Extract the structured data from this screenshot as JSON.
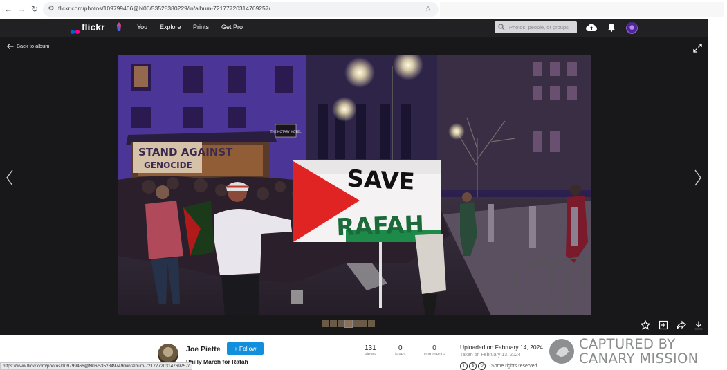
{
  "browser": {
    "url": "flickr.com/photos/109799466@N06/53528380229/in/album-72177720314769257/"
  },
  "header": {
    "logo": "flickr",
    "nav": [
      "You",
      "Explore",
      "Prints",
      "Get Pro"
    ],
    "search_placeholder": "Photos, people, or groups",
    "icons": [
      "upload-cloud-icon",
      "notification-bell-icon"
    ],
    "logo_colors": [
      "#0063dc",
      "#ff0084"
    ]
  },
  "viewer": {
    "back_label": "Back to album",
    "photo_signs": {
      "banner_top": "SAVE",
      "banner_bottom": "RAFAH",
      "sign_left": "STAND AGAINST GENOCIDE",
      "hotel_sign": "THE NOTARY HOTEL"
    },
    "filmstrip_count": 7,
    "actions": [
      "fave-star-icon",
      "add-to-album-icon",
      "share-icon",
      "download-icon"
    ]
  },
  "info": {
    "owner": "Joe Piette",
    "follow_label": "Follow",
    "title": "Philly March for Rafah",
    "stats": [
      {
        "value": "131",
        "label": "views"
      },
      {
        "value": "0",
        "label": "faves"
      },
      {
        "value": "0",
        "label": "comments"
      }
    ],
    "uploaded": "Uploaded on February 14, 2024",
    "taken": "Taken on February 13, 2024",
    "rights": "Some rights reserved",
    "follow_color": "#128fdc"
  },
  "status_url": "https://www.flickr.com/photos/109799466@N06/53528497490/in/album-72177720314769257/",
  "watermark": {
    "line1": "CAPTURED BY",
    "line2": "CANARY MISSION"
  }
}
